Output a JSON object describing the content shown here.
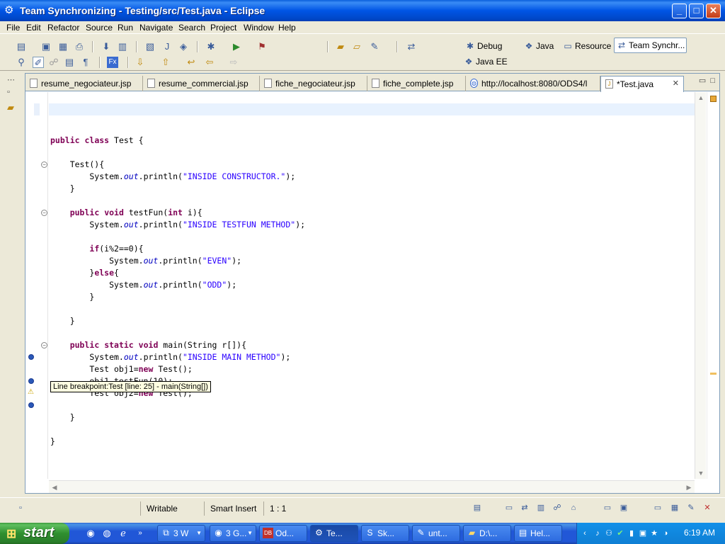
{
  "window": {
    "title": "Team Synchronizing - Testing/src/Test.java - Eclipse",
    "controls": {
      "minimize": "_",
      "maximize": "□",
      "close": "✕"
    }
  },
  "menu": [
    "File",
    "Edit",
    "Refactor",
    "Source",
    "Run",
    "Navigate",
    "Search",
    "Project",
    "Window",
    "Help"
  ],
  "perspectives": [
    {
      "label": "Debug",
      "icon": "debug-icon"
    },
    {
      "label": "Java",
      "icon": "java-icon"
    },
    {
      "label": "Resource",
      "icon": "resource-icon"
    },
    {
      "label": "Team Synchr...",
      "icon": "team-sync-icon",
      "active": true
    },
    {
      "label": "Java EE",
      "icon": "java-ee-icon"
    }
  ],
  "tabs": [
    {
      "label": "resume_negociateur.jsp"
    },
    {
      "label": "resume_commercial.jsp"
    },
    {
      "label": "fiche_negociateur.jsp"
    },
    {
      "label": "fiche_complete.jsp"
    },
    {
      "label": "http://localhost:8080/ODS4/l"
    },
    {
      "label": "*Test.java",
      "active": true
    }
  ],
  "code": {
    "l1": {
      "kw1": "public",
      "kw2": "class",
      "rest": " Test {"
    },
    "l2": {
      "text": "    Test(){"
    },
    "l3": {
      "pre": "        System.",
      "fld": "out",
      "mid": ".println(",
      "str": "\"INSIDE CONSTRUCTOR.\"",
      "end": ");"
    },
    "l4": {
      "text": "    }"
    },
    "l5": {
      "kw1": "public",
      "kw2": "void",
      "mid": " testFun(",
      "kw3": "int",
      "end": " i){"
    },
    "l6": {
      "pre": "        System.",
      "fld": "out",
      "mid": ".println(",
      "str": "\"INSIDE TESTFUN METHOD\"",
      "end": ");"
    },
    "l7": {
      "kw": "if",
      "rest": "(i%2==0){"
    },
    "l8": {
      "pre": "            System.",
      "fld": "out",
      "mid": ".println(",
      "str": "\"EVEN\"",
      "end": ");"
    },
    "l9": {
      "pre": "        }",
      "kw": "else",
      "end": "{"
    },
    "l10": {
      "pre": "            System.",
      "fld": "out",
      "mid": ".println(",
      "str": "\"ODD\"",
      "end": ");"
    },
    "l11": {
      "text": "        }"
    },
    "l12": {
      "text": "    }"
    },
    "l13": {
      "kw1": "public",
      "kw2": "static",
      "kw3": "void",
      "rest": " main(String r[]){"
    },
    "l14": {
      "pre": "        System.",
      "fld": "out",
      "mid": ".println(",
      "str": "\"INSIDE MAIN METHOD\"",
      "end": ");"
    },
    "l15": {
      "pre": "        Test obj1=",
      "kw": "new",
      "end": " Test();"
    },
    "l16": {
      "text": "        obj1.testFun(10);"
    },
    "l17": {
      "pre": "        Test obj2=",
      "kw": "new",
      "end": " Test();"
    },
    "l18": {
      "text": "    }"
    },
    "l19": {
      "text": "}"
    }
  },
  "tooltip": "Line breakpoint:Test [line: 25] - main(String[])",
  "status": {
    "mode": "Writable",
    "insert": "Smart Insert",
    "position": "1 : 1"
  },
  "taskbar": {
    "start": "start",
    "tasks": [
      {
        "label": "3 W",
        "icon": "windows-group-icon"
      },
      {
        "label": "3 G...",
        "icon": "chrome-icon"
      },
      {
        "label": "Od...",
        "icon": "oracle-icon"
      },
      {
        "label": "Te...",
        "icon": "eclipse-icon",
        "active": true
      },
      {
        "label": "Sk...",
        "icon": "skype-icon"
      },
      {
        "label": "unt...",
        "icon": "paint-icon"
      },
      {
        "label": "D:\\...",
        "icon": "folder-icon"
      },
      {
        "label": "Hel...",
        "icon": "help-icon"
      }
    ],
    "clock": "6:19 AM"
  }
}
